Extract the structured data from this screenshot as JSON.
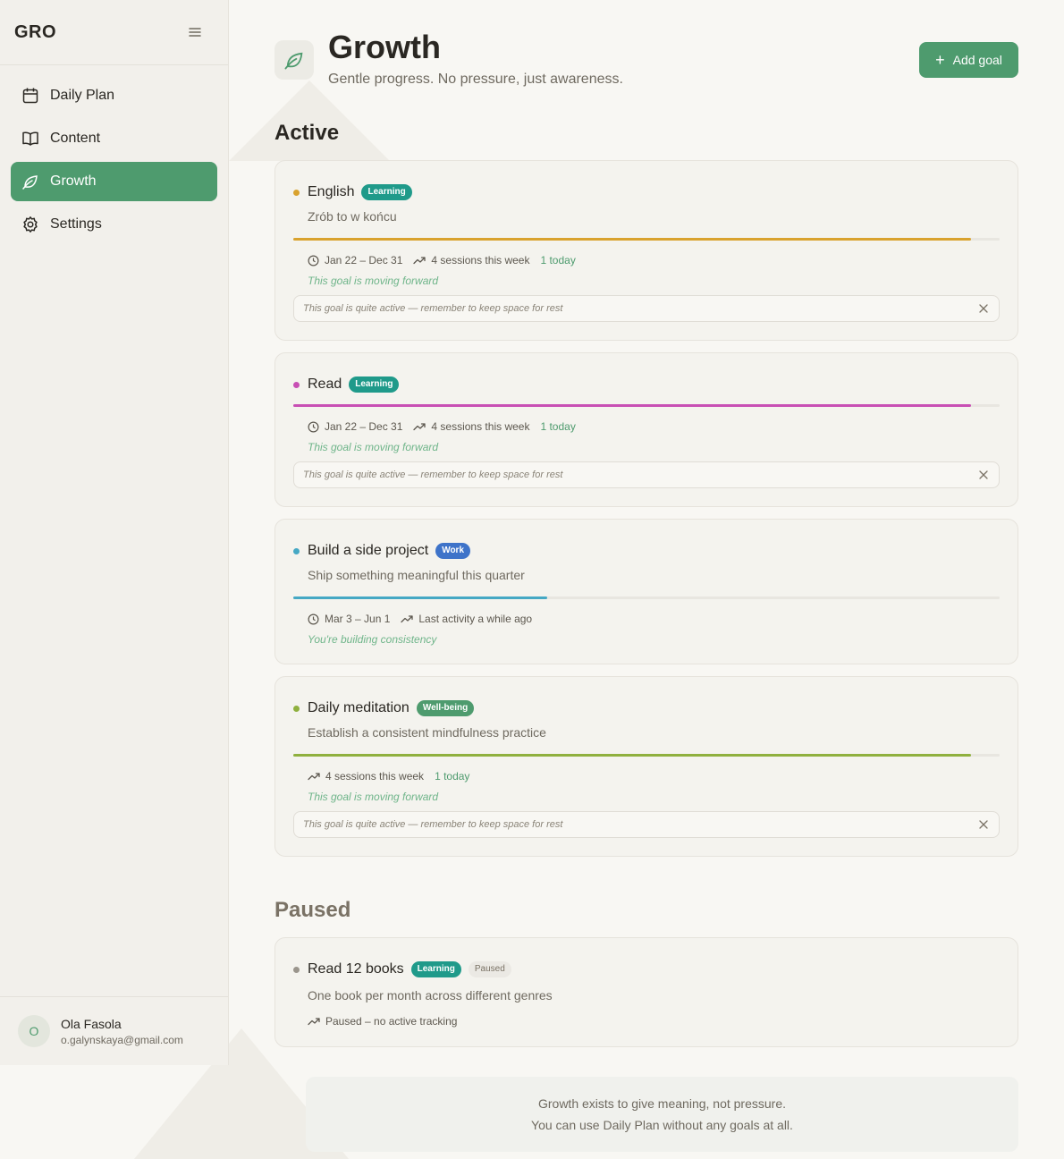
{
  "app": {
    "logo": "GRO"
  },
  "sidebar": {
    "items": [
      {
        "label": "Daily Plan",
        "icon": "calendar-icon"
      },
      {
        "label": "Content",
        "icon": "book-icon"
      },
      {
        "label": "Growth",
        "icon": "leaf-icon",
        "active": true
      },
      {
        "label": "Settings",
        "icon": "gear-icon"
      }
    ],
    "user": {
      "initial": "O",
      "name": "Ola Fasola",
      "email": "o.galynskaya@gmail.com"
    }
  },
  "header": {
    "title": "Growth",
    "subtitle": "Gentle progress. No pressure, just awareness.",
    "add_label": "Add goal"
  },
  "sections": {
    "active": "Active",
    "paused": "Paused"
  },
  "colors": {
    "accent": "#4e9b6e",
    "learning": "#1f9a8a",
    "work": "#3e73c9",
    "wellbeing": "#4e9b6e"
  },
  "goals": [
    {
      "title": "English",
      "badge": "Learning",
      "dot_color": "#d9a22e",
      "desc": "Zrób to w końcu",
      "progress": 0.96,
      "dates": "Jan 22 – Dec 31",
      "sessions": "4 sessions this week",
      "today": "1 today",
      "status": "This goal is moving forward",
      "note": "This goal is quite active — remember to keep space for rest"
    },
    {
      "title": "Read",
      "badge": "Learning",
      "dot_color": "#c84fb4",
      "progress": 0.96,
      "dates": "Jan 22 – Dec 31",
      "sessions": "4 sessions this week",
      "today": "1 today",
      "status": "This goal is moving forward",
      "note": "This goal is quite active — remember to keep space for rest"
    },
    {
      "title": "Build a side project",
      "badge": "Work",
      "dot_color": "#45a8c4",
      "desc": "Ship something meaningful this quarter",
      "progress": 0.36,
      "dates": "Mar 3 – Jun 1",
      "sessions": "Last activity a while ago",
      "status": "You're building consistency"
    },
    {
      "title": "Daily meditation",
      "badge": "Well-being",
      "dot_color": "#8fb03e",
      "desc": "Establish a consistent mindfulness practice",
      "progress": 0.96,
      "sessions": "4 sessions this week",
      "today": "1 today",
      "status": "This goal is moving forward",
      "note": "This goal is quite active — remember to keep space for rest"
    }
  ],
  "paused_goal": {
    "title": "Read 12 books",
    "badge": "Learning",
    "state": "Paused",
    "dot_color": "#9a958c",
    "desc": "One book per month across different genres",
    "tracking": "Paused – no active tracking"
  },
  "footer": {
    "line1": "Growth exists to give meaning, not pressure.",
    "line2": "You can use Daily Plan without any goals at all."
  }
}
